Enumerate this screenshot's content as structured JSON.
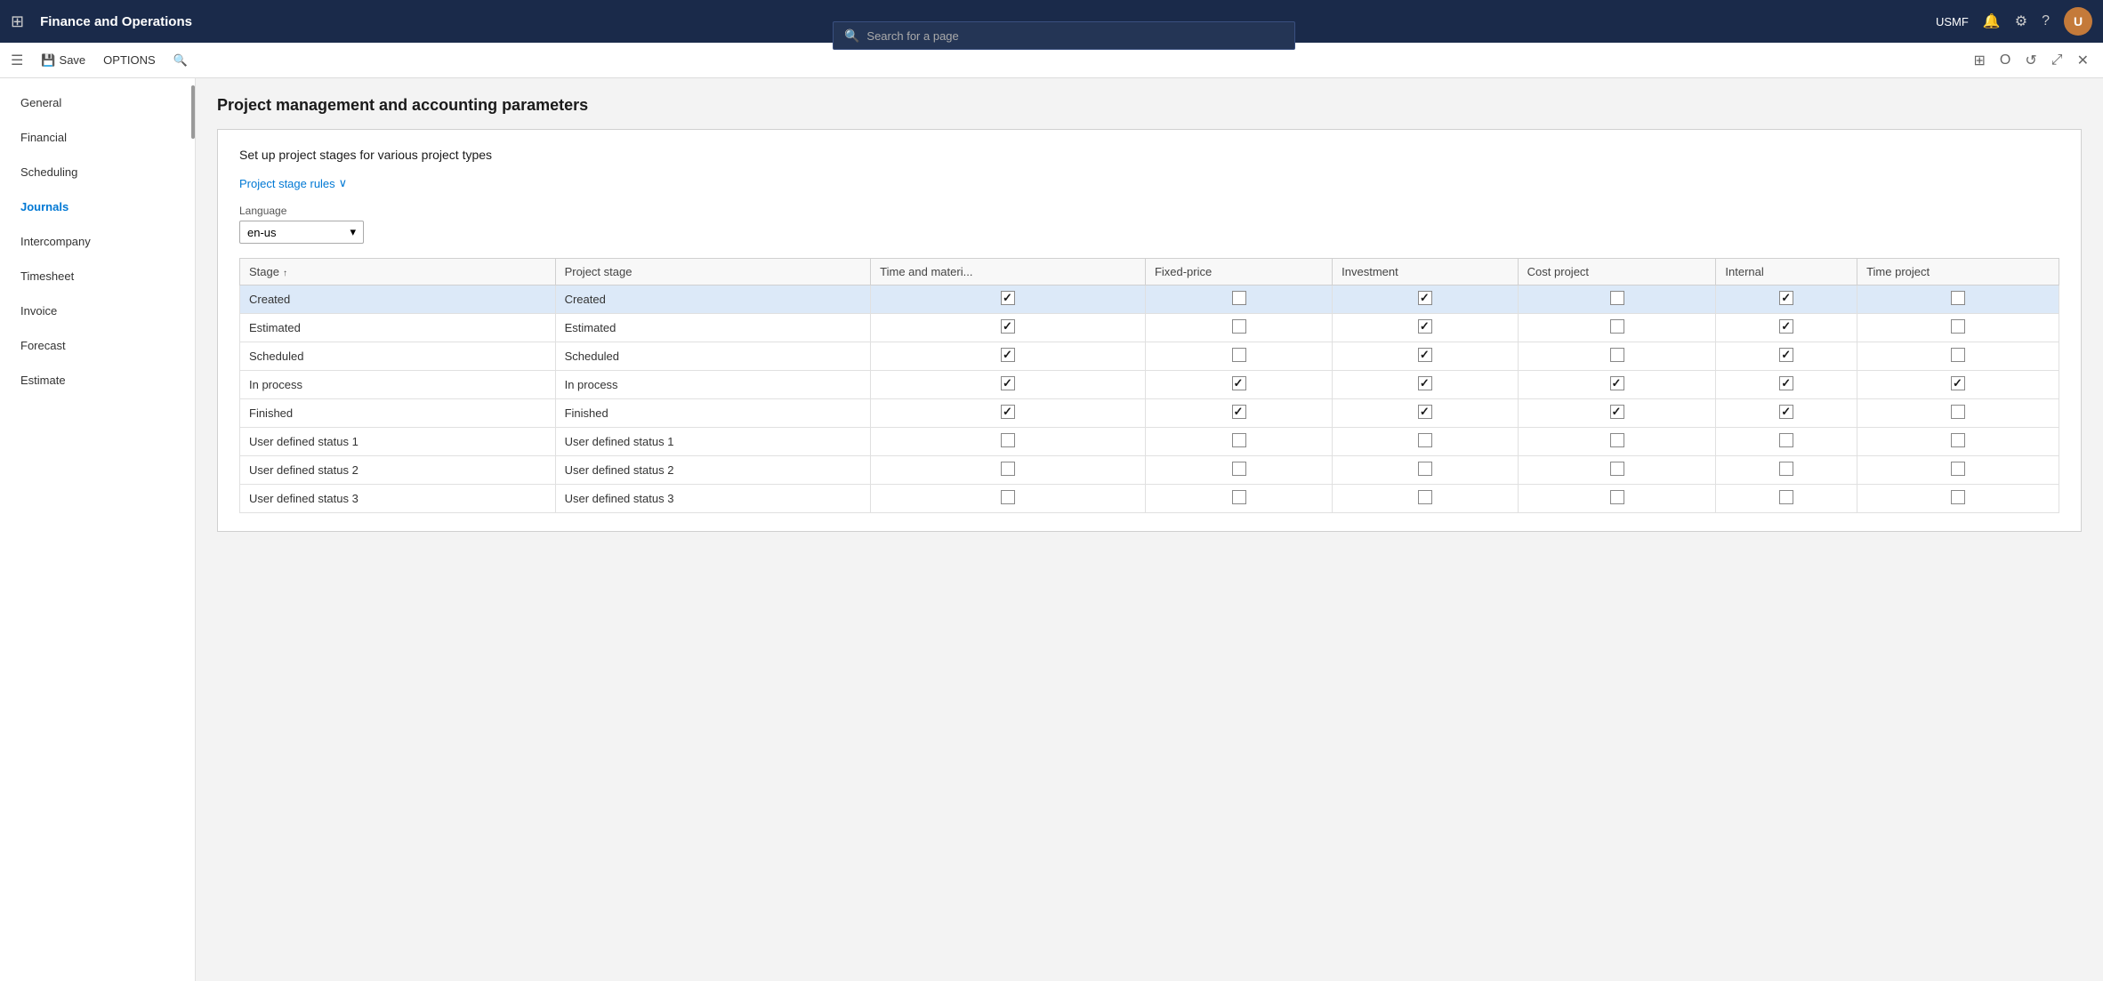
{
  "topNav": {
    "appTitle": "Finance and Operations",
    "searchPlaceholder": "Search for a page",
    "username": "USMF"
  },
  "toolbar": {
    "saveLabel": "Save",
    "optionsLabel": "OPTIONS"
  },
  "pageTitle": "Project management and accounting parameters",
  "leftNav": {
    "items": [
      {
        "id": "general",
        "label": "General"
      },
      {
        "id": "financial",
        "label": "Financial"
      },
      {
        "id": "scheduling",
        "label": "Scheduling"
      },
      {
        "id": "journals",
        "label": "Journals"
      },
      {
        "id": "intercompany",
        "label": "Intercompany"
      },
      {
        "id": "timesheet",
        "label": "Timesheet"
      },
      {
        "id": "invoice",
        "label": "Invoice"
      },
      {
        "id": "forecast",
        "label": "Forecast"
      },
      {
        "id": "estimate",
        "label": "Estimate"
      }
    ]
  },
  "content": {
    "sectionTitle": "Set up project stages for various project types",
    "projectStageRulesLabel": "Project stage rules",
    "languageLabel": "Language",
    "languageValue": "en-us",
    "tableColumns": [
      {
        "key": "stage",
        "label": "Stage",
        "sortable": true
      },
      {
        "key": "projectStage",
        "label": "Project stage"
      },
      {
        "key": "timeMaterial",
        "label": "Time and materi..."
      },
      {
        "key": "fixedPrice",
        "label": "Fixed-price"
      },
      {
        "key": "investment",
        "label": "Investment"
      },
      {
        "key": "costProject",
        "label": "Cost project"
      },
      {
        "key": "internal",
        "label": "Internal"
      },
      {
        "key": "timeProject",
        "label": "Time project"
      }
    ],
    "tableRows": [
      {
        "stage": "Created",
        "projectStage": "Created",
        "timeMaterial": true,
        "fixedPrice": false,
        "investment": true,
        "costProject": false,
        "internal": true,
        "timeProject": false,
        "selected": true
      },
      {
        "stage": "Estimated",
        "projectStage": "Estimated",
        "timeMaterial": true,
        "fixedPrice": false,
        "investment": true,
        "costProject": false,
        "internal": true,
        "timeProject": false,
        "selected": false
      },
      {
        "stage": "Scheduled",
        "projectStage": "Scheduled",
        "timeMaterial": true,
        "fixedPrice": false,
        "investment": true,
        "costProject": false,
        "internal": true,
        "timeProject": false,
        "selected": false
      },
      {
        "stage": "In process",
        "projectStage": "In process",
        "timeMaterial": true,
        "fixedPrice": true,
        "investment": true,
        "costProject": true,
        "internal": true,
        "timeProject": true,
        "selected": false
      },
      {
        "stage": "Finished",
        "projectStage": "Finished",
        "timeMaterial": true,
        "fixedPrice": true,
        "investment": true,
        "costProject": true,
        "internal": true,
        "timeProject": false,
        "selected": false
      },
      {
        "stage": "User defined status 1",
        "projectStage": "User defined status 1",
        "timeMaterial": false,
        "fixedPrice": false,
        "investment": false,
        "costProject": false,
        "internal": false,
        "timeProject": false,
        "selected": false
      },
      {
        "stage": "User defined status 2",
        "projectStage": "User defined status 2",
        "timeMaterial": false,
        "fixedPrice": false,
        "investment": false,
        "costProject": false,
        "internal": false,
        "timeProject": false,
        "selected": false
      },
      {
        "stage": "User defined status 3",
        "projectStage": "User defined status 3",
        "timeMaterial": false,
        "fixedPrice": false,
        "investment": false,
        "costProject": false,
        "internal": false,
        "timeProject": false,
        "selected": false
      }
    ]
  }
}
